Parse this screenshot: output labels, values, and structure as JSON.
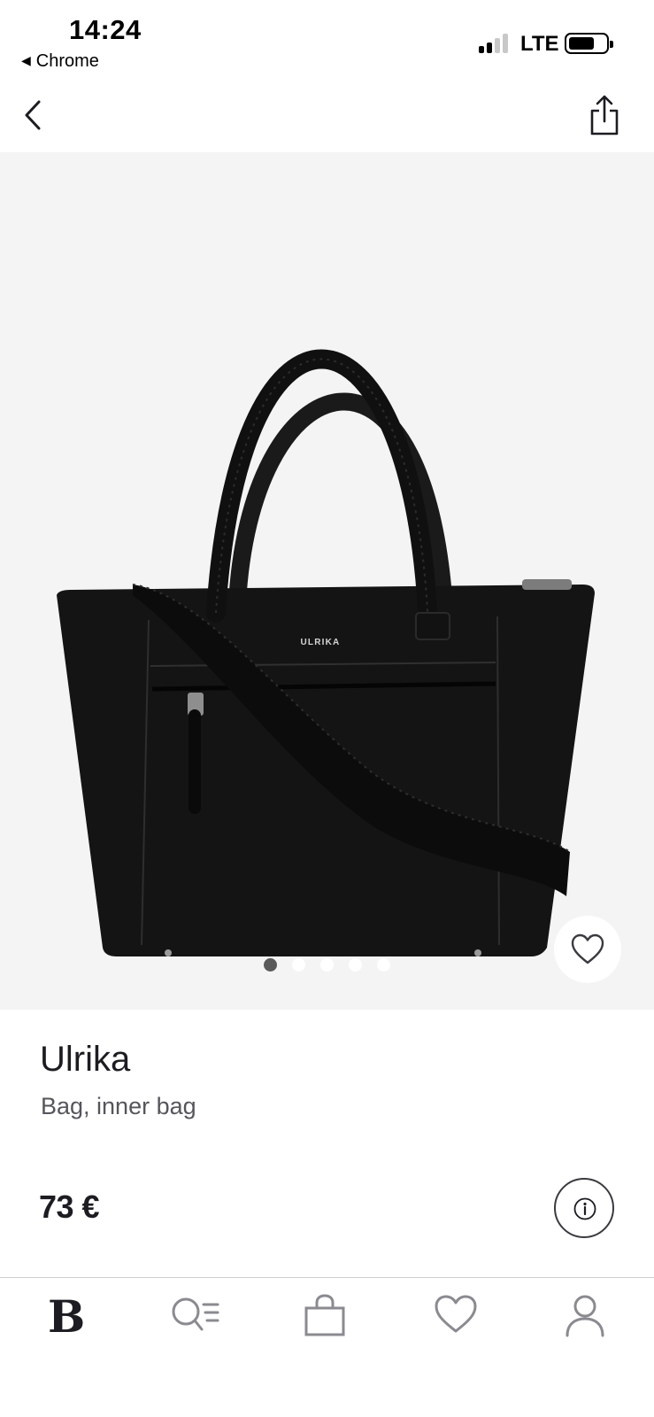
{
  "status_bar": {
    "time": "14:24",
    "back_app": "Chrome",
    "network": "LTE"
  },
  "product": {
    "brand": "Ulrika",
    "description": "Bag, inner bag",
    "price": "73 €",
    "image_label": "ULRIKA",
    "gallery": {
      "count": 5,
      "active_index": 0
    }
  },
  "icons": {
    "back": "chevron-left-icon",
    "share": "share-icon",
    "favorite": "heart-icon",
    "info": "info-icon"
  },
  "tab_bar": {
    "items": [
      {
        "name": "home",
        "icon": "brand-logo-icon",
        "glyph": "B"
      },
      {
        "name": "search",
        "icon": "search-list-icon"
      },
      {
        "name": "bag",
        "icon": "shopping-bag-icon"
      },
      {
        "name": "favorites",
        "icon": "heart-icon"
      },
      {
        "name": "profile",
        "icon": "person-icon"
      }
    ]
  },
  "colors": {
    "text_primary": "#1c1c22",
    "text_secondary": "#55555c",
    "image_background": "#f4f4f4",
    "icon_gray": "#8a8a90"
  }
}
